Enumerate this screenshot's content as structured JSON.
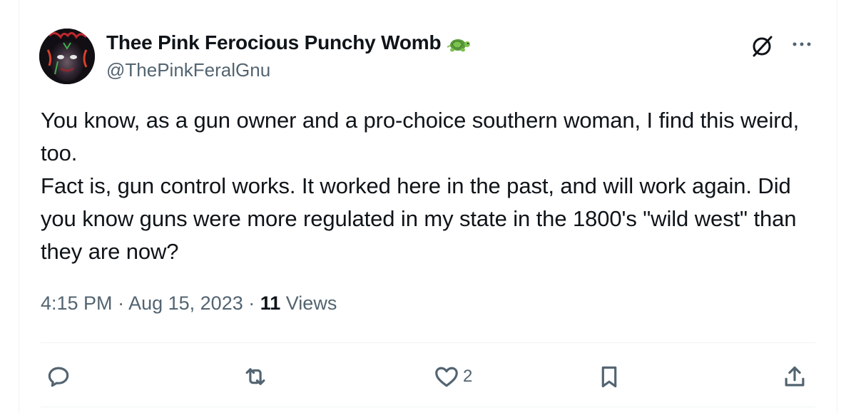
{
  "author": {
    "display_name": "Thee Pink Ferocious Punchy Womb",
    "badge_icon": "turtle-icon",
    "handle": "@ThePinkFeralGnu"
  },
  "tweet": {
    "lines": [
      "You know, as a gun owner and a pro-choice southern woman, I find this weird, too.",
      "Fact is, gun control works. It worked here in the past, and will work again. Did you know guns were more regulated in my state in the 1800's \"wild west\" than they are now?"
    ]
  },
  "meta": {
    "time": "4:15 PM",
    "separator1": " · ",
    "date": "Aug 15, 2023",
    "separator2": " · ",
    "views_count": "11",
    "views_label": " Views"
  },
  "actions": {
    "reply_icon": "reply-icon",
    "repost_icon": "repost-icon",
    "like_icon": "heart-icon",
    "like_count": "2",
    "bookmark_icon": "bookmark-icon",
    "share_icon": "share-icon"
  },
  "colors": {
    "text": "#0f1419",
    "secondary": "#536471",
    "divider": "#eff3f4"
  }
}
